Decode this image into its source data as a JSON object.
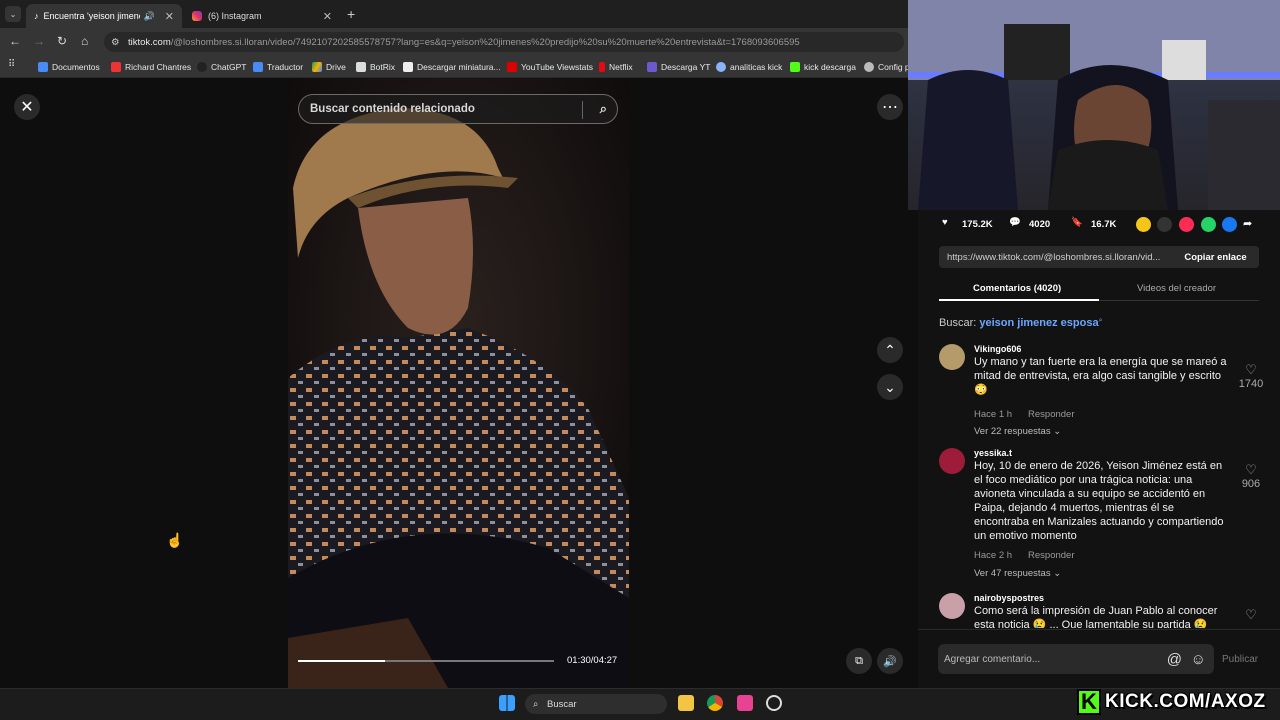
{
  "browser": {
    "tabs": [
      {
        "title": "Encuentra 'yeison jimenes p",
        "active": true
      },
      {
        "title": "(6) Instagram",
        "active": false
      }
    ],
    "url_host": "tiktok.com",
    "url_path": "/@loshombres.si.lloran/video/7492107202585578757?lang=es&q=yeison%20jimenes%20predijo%20su%20muerte%20entrevista&t=1768093606595",
    "bookmarks": [
      "Documentos",
      "Richard Chantres",
      "ChatGPT",
      "Traductor",
      "Drive",
      "BotRix",
      "Descargar miniatura...",
      "YouTube Viewstats",
      "Netflix",
      "Descarga YT",
      "analiticas kick",
      "kick descarga",
      "Config p"
    ]
  },
  "player": {
    "search_placeholder": "Buscar contenido relacionado",
    "time": "01:30/04:27",
    "progress": 0.34
  },
  "panel": {
    "likes": "175.2K",
    "comments": "4020",
    "saves": "16.7K",
    "link": "https://www.tiktok.com/@loshombres.si.lloran/vid...",
    "copy_label": "Copiar enlace",
    "tab_comments": "Comentarios (4020)",
    "tab_videos": "Videos del creador",
    "search_prefix": "Buscar:",
    "search_term": "yeison jimenez esposa",
    "comment_placeholder": "Agregar comentario...",
    "publish_label": "Publicar"
  },
  "comments": [
    {
      "user": "Vikingo606",
      "text": "Uy mano y tan fuerte era la energía que se mareó a mitad de entrevista, era algo casi tangible y escrito 😳",
      "time": "Hace 1 h",
      "reply": "Responder",
      "replies": "Ver 22 respuestas",
      "likes": "1740"
    },
    {
      "user": "yessika.t",
      "text": "Hoy, 10 de enero de 2026, Yeison Jiménez está en el foco mediático por una trágica noticia: una avioneta vinculada a su equipo se accidentó en Paipa, dejando 4 muertos, mientras él se encontraba en Manizales actuando y compartiendo un emotivo momento",
      "time": "Hace 2 h",
      "reply": "Responder",
      "replies": "Ver 47 respuestas",
      "likes": "906"
    },
    {
      "user": "nairobyspostres",
      "text": "Como será la impresión de Juan Pablo al conocer esta noticia 😢 ... Que lamentable su partida 😢",
      "likes": ""
    }
  ],
  "taskbar": {
    "search": "Buscar"
  },
  "overlay": {
    "kick": "KICK.COM/AXOZ"
  }
}
